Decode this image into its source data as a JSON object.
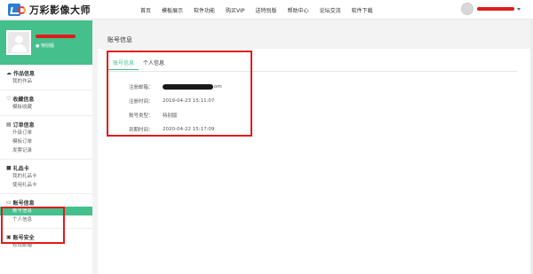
{
  "brand": {
    "name": "万彩影像大师"
  },
  "nav": {
    "items": [
      "首页",
      "模板展示",
      "软件功能",
      "购买VIP",
      "送特别版",
      "帮助中心",
      "论坛交流",
      "软件下载"
    ]
  },
  "profile": {
    "level": "特别版"
  },
  "sidebar": {
    "sections": [
      {
        "title": "作品信息",
        "icon": "cloud-icon",
        "items": [
          "我的作品"
        ]
      },
      {
        "title": "收藏信息",
        "icon": "heart-icon",
        "items": [
          "模板收藏"
        ]
      },
      {
        "title": "订单信息",
        "icon": "order-icon",
        "items": [
          "升级订单",
          "模板订单",
          "发票记录"
        ]
      },
      {
        "title": "礼品卡",
        "icon": "gift-icon",
        "items": [
          "我的礼品卡",
          "使用礼品卡"
        ]
      },
      {
        "title": "账号信息",
        "icon": "id-card-icon",
        "items": [
          "账号信息",
          "个人信息"
        ],
        "active_index": 0
      },
      {
        "title": "账号安全",
        "icon": "lock-icon",
        "items": [
          "修改邮箱"
        ]
      }
    ]
  },
  "main": {
    "title": "账号信息",
    "tabs": [
      "账号信息",
      "个人信息"
    ],
    "active_tab": 0,
    "fields": {
      "email_label": "注册邮箱：",
      "email_suffix": "om",
      "reg_time_label": "注册时间：",
      "reg_time": "2019-04-23 15:11:07",
      "type_label": "账号类型：",
      "type": "特别版",
      "expire_label": "到期时间：",
      "expire": "2020-04-22 15:17:09"
    }
  },
  "colors": {
    "accent": "#45bf8c",
    "highlight": "#e01b1b"
  }
}
